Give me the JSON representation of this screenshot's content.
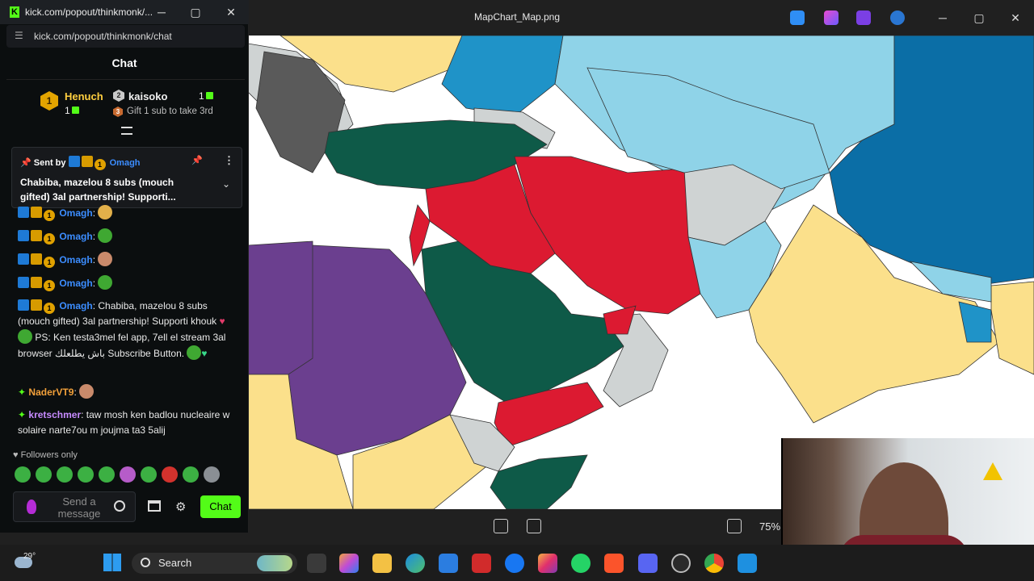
{
  "viewer": {
    "title": "MapChart_Map.png",
    "zoom": "75%",
    "win_min": "─",
    "win_max": "▢",
    "win_close": "✕"
  },
  "map": {
    "colors": {
      "dark_green": "#0e5a48",
      "red": "#dc1a31",
      "purple": "#6b3f8f",
      "light_blue": "#8fd3e8",
      "mid_blue": "#1f93c8",
      "dark_blue": "#0b6ea6",
      "yellow": "#fbe08b",
      "gray": "#cfd3d3",
      "dark_gray": "#5a5a5a",
      "water": "#ffffff"
    }
  },
  "chat": {
    "window_title": "kick.com/popout/thinkmonk/...",
    "url": "kick.com/popout/thinkmonk/chat",
    "header": "Chat",
    "leaderboard": {
      "first_name": "Henuch",
      "first_rank": "1",
      "first_count": "1",
      "second_name": "kaisoko",
      "second_rank": "2",
      "second_count": "1",
      "third_rank": "3",
      "third_text": "Gift 1 sub to take 3rd"
    },
    "pinned": {
      "sent_by": "Sent by",
      "user": "Omagh",
      "text": "Chabiba, mazelou 8 subs (mouch gifted) 3al partnership! Supporti..."
    },
    "messages": [
      {
        "user": "Omagh",
        "sep": ":"
      },
      {
        "user": "Omagh",
        "sep": ":"
      },
      {
        "user": "Omagh",
        "sep": ":"
      },
      {
        "user": "Omagh",
        "sep": ":"
      },
      {
        "user": "Omagh",
        "sep": ":",
        "text1": " Chabiba, mazelou 8 subs (mouch gifted) 3al partnership! Supporti khouk ",
        "text2": " PS: Ken testa3mel fel app, 7ell el stream 3al browser باش يطلعلك Subscribe Button. "
      },
      {
        "user": "NaderVT9",
        "sep": ":"
      },
      {
        "user": "kretschmer",
        "sep": ":",
        "text1": " taw mosh ken badlou nucleaire w solaire narte7ou m joujma ta3 5alij"
      }
    ],
    "followers_only": "Followers only",
    "input_placeholder": "Send a message",
    "send_label": "Chat"
  },
  "taskbar": {
    "weather": "29°",
    "search_label": "Search"
  }
}
